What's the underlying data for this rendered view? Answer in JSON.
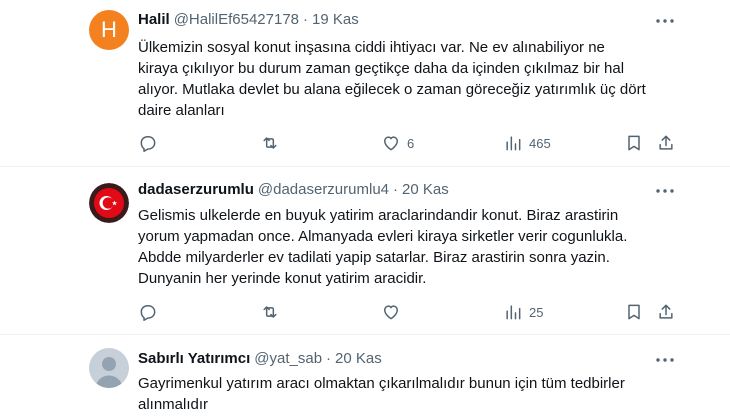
{
  "tweets": [
    {
      "name": "Halil",
      "handle": "@HalilEf65427178",
      "separator": "·",
      "date": "19 Kas",
      "avatar_letter": "H",
      "avatar_color": "#f4811f",
      "text_lines": [
        "Ülkemizin sosyal konut inşasına ciddi ihtiyacı var. Ne ev alınabiliyor ne",
        "kiraya çıkılıyor bu durum zaman geçtikçe daha da içinden çıkılmaz bir hal",
        "alıyor. Mutlaka devlet bu alana eğilecek o zaman göreceğiz yatırımlık üç dört",
        "daire alanları"
      ],
      "likes": "6",
      "views": "465"
    },
    {
      "name": "dadaserzurumlu",
      "handle": "@dadaserzurumlu4",
      "separator": "·",
      "date": "20 Kas",
      "text_lines": [
        "Gelismis ulkelerde en buyuk yatirim araclarindandir konut. Biraz arastirin",
        "yorum yapmadan once. Almanyada evleri kiraya sirketler verir cogunlukla.",
        "Abdde milyarderler ev tadilati yapip satarlar. Biraz arastirin sonra yazin.",
        "Dunyanin her yerinde konut yatirim aracidir."
      ],
      "views": "25"
    },
    {
      "name": "Sabırlı Yatırımcı",
      "handle": "@yat_sab",
      "separator": "·",
      "date": "20 Kas",
      "text_lines": [
        "Gayrimenkul yatırım aracı olmaktan çıkarılmalıdır bunun için tüm tedbirler",
        "alınmalıdır"
      ]
    }
  ],
  "colors": {
    "text_primary": "#0f1419",
    "text_secondary": "#536471",
    "divider": "#eff3f4",
    "flag_red": "#e30a17"
  },
  "icons": [
    "reply-icon",
    "retweet-icon",
    "like-icon",
    "views-icon",
    "bookmark-icon",
    "share-icon",
    "more-icon"
  ]
}
